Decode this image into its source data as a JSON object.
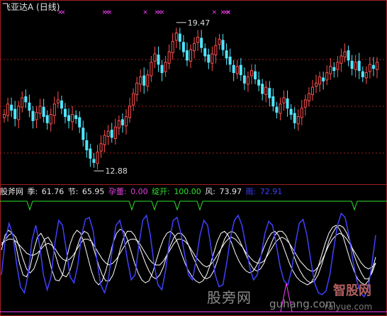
{
  "window": {
    "title": "飞亚达A (日线)",
    "high_label": "19.47",
    "low_label": "12.88"
  },
  "indicator": {
    "name": "股斧网",
    "items": [
      {
        "label": "季:",
        "value": "61.76",
        "label_color": "#e6e6e6",
        "value_color": "#e6e6e6"
      },
      {
        "label": "节:",
        "value": "65.95",
        "label_color": "#e6e6e6",
        "value_color": "#e6e6e6"
      },
      {
        "label": "孕蕾:",
        "value": "0.00",
        "label_color": "#e040e0",
        "value_color": "#e040e0"
      },
      {
        "label": "绽开:",
        "value": "100.00",
        "label_color": "#30e030",
        "value_color": "#30e030"
      },
      {
        "label": "风:",
        "value": "73.97",
        "label_color": "#e6e6e6",
        "value_color": "#e6e6e6"
      },
      {
        "label": "雨:",
        "value": "72.91",
        "label_color": "#4040ff",
        "value_color": "#4040ff"
      }
    ]
  },
  "watermark": {
    "site1": "股旁网",
    "site1_url": "guhang.com",
    "site2": "智股网",
    "site2_url": "raiyue.com"
  },
  "colors": {
    "up": "#ff5050",
    "down": "#50e6ff",
    "grid": "#a02020",
    "white_line": "#ffffff",
    "blue_line": "#4040ff",
    "green_line": "#30e030",
    "magenta": "#ff40ff"
  },
  "chart_data": [
    {
      "type": "candlestick",
      "title": "飞亚达A (日线)",
      "price_range": [
        12.4,
        20.2
      ],
      "annotations": [
        {
          "text": "19.47",
          "kind": "high"
        },
        {
          "text": "12.88",
          "kind": "low"
        }
      ],
      "closes": [
        15.4,
        15.9,
        15.6,
        15.2,
        15.8,
        16.2,
        16.0,
        15.6,
        15.1,
        15.5,
        15.8,
        15.3,
        15.0,
        15.4,
        15.9,
        16.1,
        15.7,
        15.3,
        15.1,
        15.4,
        15.2,
        14.8,
        14.2,
        13.7,
        13.3,
        13.1,
        13.6,
        14.0,
        14.4,
        14.6,
        14.3,
        14.8,
        15.1,
        14.9,
        15.3,
        15.8,
        16.4,
        16.9,
        17.2,
        16.8,
        17.3,
        17.9,
        18.3,
        17.8,
        17.4,
        17.9,
        18.4,
        18.9,
        19.3,
        18.9,
        18.4,
        18.0,
        18.5,
        18.8,
        19.1,
        18.6,
        18.2,
        17.9,
        18.3,
        18.7,
        19.0,
        18.5,
        18.1,
        17.8,
        17.4,
        17.7,
        17.3,
        16.9,
        17.2,
        17.5,
        17.1,
        16.8,
        16.4,
        16.7,
        16.2,
        15.8,
        15.5,
        15.9,
        16.2,
        15.7,
        15.4,
        15.0,
        15.3,
        15.7,
        16.1,
        16.4,
        16.7,
        16.9,
        17.2,
        17.0,
        17.4,
        17.7,
        17.5,
        17.9,
        18.2,
        18.4,
        18.0,
        17.6,
        17.9,
        17.5,
        17.2,
        17.4,
        17.8,
        17.6,
        17.9
      ]
    },
    {
      "type": "line",
      "series": [
        {
          "name": "季",
          "color": "#ffffff",
          "values": [
            55,
            70,
            75,
            72,
            60,
            42,
            30,
            28,
            38,
            55,
            68,
            72,
            65,
            50,
            35,
            25,
            24,
            30,
            45,
            60,
            70,
            75,
            72,
            62,
            48,
            34,
            24,
            20,
            24,
            34,
            48,
            62,
            72,
            76,
            74,
            66,
            54,
            42,
            32,
            25,
            22,
            24,
            32,
            44,
            56,
            66,
            72,
            74,
            70,
            62,
            52,
            42,
            34,
            28,
            24,
            22,
            24,
            30,
            40,
            52,
            64,
            72,
            74,
            70,
            62,
            52,
            44,
            38,
            34,
            32,
            34,
            40,
            48,
            58,
            66,
            72,
            74,
            70,
            62,
            52,
            42,
            34,
            28,
            24,
            22,
            20,
            22,
            28,
            38,
            50,
            62,
            72,
            78,
            80,
            76,
            68,
            56,
            44,
            34,
            26,
            22,
            20,
            24,
            34,
            48
          ]
        },
        {
          "name": "节",
          "color": "#ffffff",
          "values": [
            60,
            65,
            70,
            72,
            68,
            58,
            46,
            36,
            32,
            36,
            46,
            58,
            66,
            68,
            62,
            50,
            38,
            30,
            28,
            34,
            46,
            58,
            68,
            74,
            72,
            64,
            52,
            40,
            30,
            24,
            24,
            30,
            42,
            56,
            68,
            74,
            74,
            70,
            62,
            52,
            42,
            34,
            28,
            26,
            30,
            38,
            50,
            60,
            68,
            72,
            72,
            68,
            60,
            50,
            42,
            34,
            28,
            26,
            28,
            34,
            44,
            56,
            66,
            72,
            74,
            72,
            66,
            58,
            50,
            42,
            36,
            34,
            36,
            42,
            52,
            62,
            70,
            74,
            74,
            70,
            62,
            52,
            42,
            34,
            28,
            24,
            22,
            24,
            30,
            40,
            52,
            64,
            72,
            78,
            80,
            78,
            72,
            62,
            50,
            40,
            32,
            26,
            26,
            32,
            42
          ]
        },
        {
          "name": "风",
          "color": "#ffffff",
          "values": [
            62,
            64,
            66,
            66,
            64,
            60,
            56,
            52,
            50,
            50,
            52,
            56,
            60,
            62,
            60,
            56,
            50,
            46,
            44,
            46,
            50,
            56,
            62,
            66,
            66,
            64,
            58,
            52,
            46,
            42,
            40,
            42,
            46,
            52,
            58,
            64,
            66,
            66,
            64,
            58,
            52,
            46,
            42,
            40,
            40,
            44,
            50,
            56,
            62,
            66,
            66,
            64,
            60,
            54,
            48,
            44,
            40,
            38,
            40,
            44,
            50,
            56,
            62,
            66,
            68,
            66,
            62,
            58,
            52,
            48,
            44,
            42,
            42,
            44,
            50,
            56,
            62,
            66,
            68,
            66,
            62,
            56,
            50,
            44,
            40,
            36,
            34,
            34,
            38,
            44,
            52,
            60,
            66,
            70,
            72,
            70,
            66,
            60,
            54,
            48,
            42,
            38,
            36,
            38,
            42
          ]
        },
        {
          "name": "雨",
          "color": "#4040ff",
          "values": [
            30,
            65,
            82,
            70,
            40,
            18,
            12,
            30,
            65,
            80,
            60,
            30,
            15,
            28,
            62,
            85,
            80,
            55,
            28,
            22,
            40,
            70,
            86,
            88,
            75,
            45,
            20,
            12,
            25,
            55,
            80,
            85,
            70,
            45,
            25,
            30,
            60,
            85,
            90,
            70,
            40,
            20,
            15,
            35,
            65,
            85,
            88,
            72,
            50,
            30,
            25,
            45,
            70,
            85,
            80,
            55,
            30,
            18,
            20,
            42,
            68,
            85,
            90,
            80,
            60,
            38,
            25,
            30,
            50,
            72,
            84,
            80,
            60,
            38,
            24,
            20,
            35,
            62,
            82,
            86,
            70,
            45,
            22,
            12,
            10,
            14,
            30,
            56,
            80,
            92,
            88,
            70,
            45,
            25,
            12,
            8,
            16,
            40,
            70
          ]
        },
        {
          "name": "绽开",
          "color": "#30e030",
          "values": [
            100,
            100,
            100,
            100,
            100,
            100,
            100,
            100,
            100,
            100,
            100,
            100,
            100,
            100,
            100,
            100,
            100,
            100,
            100,
            100,
            100,
            100,
            100,
            100,
            100,
            100,
            100,
            100,
            100,
            100,
            100,
            100,
            100,
            100,
            100,
            100,
            100,
            100,
            100,
            100,
            100,
            100,
            100,
            100,
            100,
            100,
            100,
            100,
            100,
            100,
            100,
            100,
            100,
            100,
            100,
            100,
            100,
            100,
            100,
            100,
            100,
            100,
            100,
            100,
            100,
            100,
            100,
            100,
            100,
            100,
            100,
            100,
            100,
            100,
            100,
            100,
            100,
            100,
            100,
            100,
            100,
            100,
            100,
            100,
            100,
            100,
            100,
            100,
            100,
            100,
            100,
            100,
            100,
            100,
            100,
            100,
            100,
            100,
            100,
            100,
            100,
            100,
            100,
            100,
            100
          ]
        }
      ]
    }
  ]
}
